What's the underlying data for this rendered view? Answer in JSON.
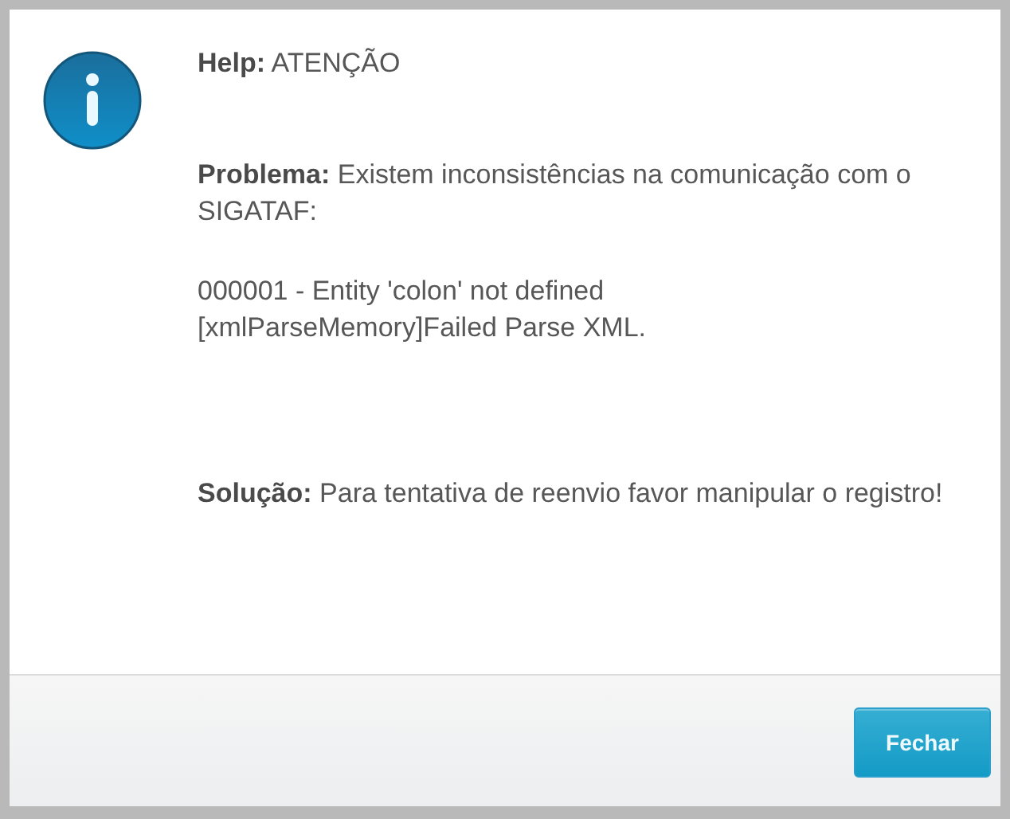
{
  "help": {
    "label": "Help:",
    "text": "ATENÇÃO"
  },
  "problem": {
    "label": "Problema:",
    "text": "Existem inconsistências na comunicação com o SIGATAF:"
  },
  "details": [
    "000001 - Entity 'colon' not defined",
    "[xmlParseMemory]Failed Parse XML."
  ],
  "solution": {
    "label": "Solução:",
    "text": "Para tentativa de reenvio favor manipular o registro!"
  },
  "buttons": [
    "Fechar"
  ]
}
